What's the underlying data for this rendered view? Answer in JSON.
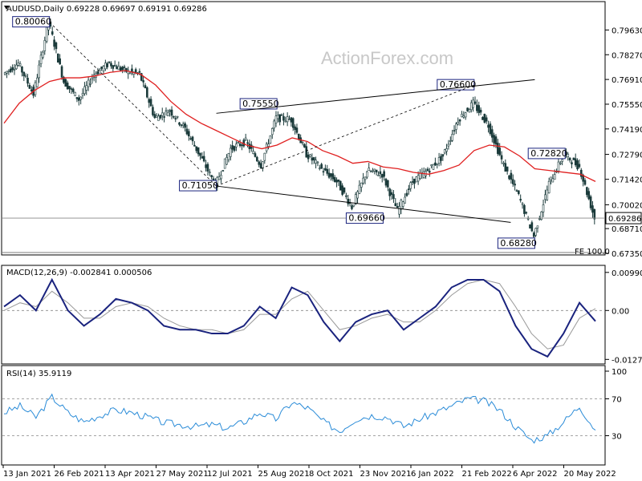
{
  "watermark": "ActionForex.com",
  "dates": [
    "13 Jan 2021",
    "26 Feb 2021",
    "13 Apr 2021",
    "27 May 2021",
    "12 Jul 2021",
    "25 Aug 2021",
    "8 Oct 2021",
    "23 Nov 2021",
    "6 Jan 2022",
    "21 Feb 2022",
    "6 Apr 2022",
    "20 May 2022"
  ],
  "chart_data": [
    {
      "type": "candlestick",
      "title": "AUDUSD,Daily  0.69228 0.69697 0.69191 0.69286",
      "symbol": "AUDUSD,Daily",
      "ohlc": [
        "0.69228",
        "0.69697",
        "0.69191",
        "0.69286"
      ],
      "current_price_label": "0.69286",
      "y_ticks": [
        "0.79630",
        "0.78270",
        "0.76910",
        "0.75550",
        "0.74190",
        "0.72790",
        "0.71420",
        "0.70020",
        "0.68710",
        "0.67350"
      ],
      "ylim": [
        0.6735,
        0.8075
      ],
      "price_points": [
        {
          "date": "13 Jan 2021",
          "close": 0.772
        },
        {
          "date": "Jan 2021",
          "close": 0.778
        },
        {
          "date": "Feb 2021",
          "close": 0.761
        },
        {
          "date": "26 Feb 2021",
          "close": 0.801
        },
        {
          "date": "Mar 2021",
          "close": 0.768
        },
        {
          "date": "Mar 2021",
          "close": 0.758
        },
        {
          "date": "13 Apr 2021",
          "close": 0.772
        },
        {
          "date": "Apr 2021",
          "close": 0.778
        },
        {
          "date": "May 2021",
          "close": 0.774
        },
        {
          "date": "27 May 2021",
          "close": 0.772
        },
        {
          "date": "Jun 2021",
          "close": 0.748
        },
        {
          "date": "Jul 2021",
          "close": 0.752
        },
        {
          "date": "12 Jul 2021",
          "close": 0.742
        },
        {
          "date": "Aug 2021",
          "close": 0.727
        },
        {
          "date": "Aug 2021",
          "close": 0.711
        },
        {
          "date": "25 Aug 2021",
          "close": 0.731
        },
        {
          "date": "Sep 2021",
          "close": 0.735
        },
        {
          "date": "Sep 2021",
          "close": 0.722
        },
        {
          "date": "8 Oct 2021",
          "close": 0.748
        },
        {
          "date": "Oct 2021",
          "close": 0.747
        },
        {
          "date": "Nov 2021",
          "close": 0.728
        },
        {
          "date": "Nov 2021",
          "close": 0.72
        },
        {
          "date": "23 Nov 2021",
          "close": 0.713
        },
        {
          "date": "Dec 2021",
          "close": 0.699
        },
        {
          "date": "Dec 2021",
          "close": 0.719
        },
        {
          "date": "6 Jan 2022",
          "close": 0.717
        },
        {
          "date": "Jan 2022",
          "close": 0.697
        },
        {
          "date": "Feb 2022",
          "close": 0.713
        },
        {
          "date": "Feb 2022",
          "close": 0.719
        },
        {
          "date": "21 Feb 2022",
          "close": 0.727
        },
        {
          "date": "Mar 2022",
          "close": 0.747
        },
        {
          "date": "6 Apr 2022",
          "close": 0.756
        },
        {
          "date": "Apr 2022",
          "close": 0.744
        },
        {
          "date": "Apr 2022",
          "close": 0.722
        },
        {
          "date": "May 2022",
          "close": 0.705
        },
        {
          "date": "May 2022",
          "close": 0.683
        },
        {
          "date": "20 May 2022",
          "close": 0.712
        },
        {
          "date": "Jun 2022",
          "close": 0.728
        },
        {
          "date": "Jun 2022",
          "close": 0.721
        },
        {
          "date": "Jun 2022",
          "close": 0.6929
        }
      ],
      "ma_points": [
        0.745,
        0.756,
        0.763,
        0.768,
        0.77,
        0.77,
        0.771,
        0.773,
        0.774,
        0.772,
        0.766,
        0.757,
        0.75,
        0.745,
        0.741,
        0.737,
        0.733,
        0.731,
        0.733,
        0.737,
        0.735,
        0.73,
        0.727,
        0.723,
        0.724,
        0.721,
        0.72,
        0.718,
        0.717,
        0.719,
        0.722,
        0.73,
        0.733,
        0.732,
        0.727,
        0.72,
        0.719,
        0.718,
        0.717,
        0.713
      ],
      "annotations": [
        {
          "label": "0.80060",
          "date": "26 Feb 2021",
          "price": 0.8006
        },
        {
          "label": "0.71050",
          "date": "Aug 2021",
          "price": 0.7105
        },
        {
          "label": "0.75550",
          "date": "Oct 2021",
          "price": 0.7555
        },
        {
          "label": "0.69660",
          "date": "Dec 2021",
          "price": 0.6966
        },
        {
          "label": "0.76600",
          "date": "Apr 2022",
          "price": 0.766
        },
        {
          "label": "0.68280",
          "date": "May 2022",
          "price": 0.6828
        },
        {
          "label": "0.72820",
          "date": "Jun 2022",
          "price": 0.7282
        }
      ],
      "fe_label": "FE 100.0"
    },
    {
      "type": "line",
      "title": "MACD(12,26,9) -0.002841 0.000506",
      "y_ticks": [
        "0.009906",
        "0.00",
        "-0.012733"
      ],
      "ylim": [
        -0.0135,
        0.0107
      ],
      "macd": [
        0.001,
        0.004,
        0.0,
        0.008,
        0.0,
        -0.004,
        -0.001,
        0.003,
        0.002,
        0.0,
        -0.004,
        -0.005,
        -0.005,
        -0.006,
        -0.006,
        -0.004,
        0.001,
        -0.002,
        0.006,
        0.004,
        -0.003,
        -0.008,
        -0.003,
        -0.001,
        0.0,
        -0.005,
        -0.002,
        0.001,
        0.006,
        0.008,
        0.008,
        0.005,
        -0.004,
        -0.01,
        -0.012,
        -0.006,
        0.002,
        -0.0028
      ],
      "signal": [
        0.0,
        0.002,
        0.001,
        0.005,
        0.002,
        -0.002,
        -0.002,
        0.001,
        0.002,
        0.001,
        -0.002,
        -0.004,
        -0.005,
        -0.005,
        -0.006,
        -0.005,
        -0.001,
        -0.001,
        0.003,
        0.005,
        0.0,
        -0.005,
        -0.004,
        -0.002,
        -0.001,
        -0.003,
        -0.003,
        0.0,
        0.004,
        0.007,
        0.008,
        0.007,
        0.001,
        -0.006,
        -0.01,
        -0.009,
        -0.002,
        0.0005
      ]
    },
    {
      "type": "line",
      "title": "RSI(14) 35.9119",
      "y_ticks": [
        "100",
        "70",
        "30"
      ],
      "ylim": [
        0,
        100
      ],
      "rsi": [
        55,
        62,
        50,
        72,
        55,
        45,
        52,
        58,
        55,
        50,
        44,
        42,
        40,
        42,
        38,
        45,
        55,
        48,
        66,
        60,
        45,
        35,
        48,
        52,
        50,
        40,
        48,
        55,
        62,
        70,
        68,
        58,
        40,
        25,
        30,
        45,
        62,
        36
      ]
    }
  ]
}
